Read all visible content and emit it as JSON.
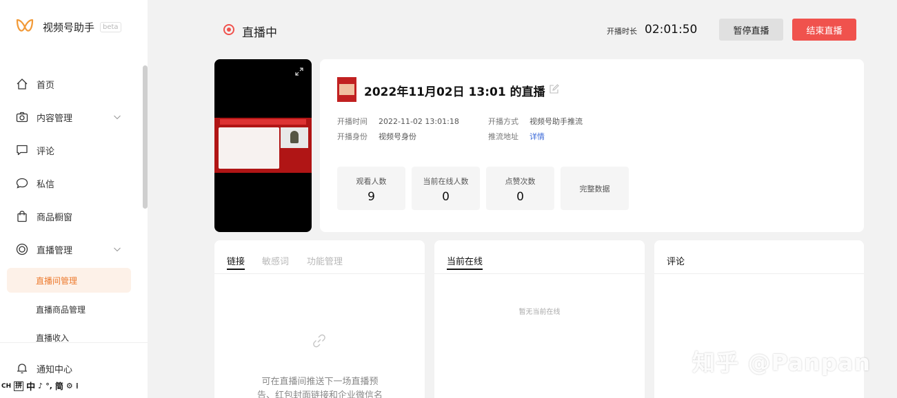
{
  "brand": {
    "name": "视频号助手",
    "badge": "beta",
    "accent": "#f29a38"
  },
  "sidebar": {
    "items": [
      {
        "label": "首页",
        "icon": "home-icon"
      },
      {
        "label": "内容管理",
        "icon": "camera-icon",
        "expandable": true
      },
      {
        "label": "评论",
        "icon": "comment-icon"
      },
      {
        "label": "私信",
        "icon": "message-icon"
      },
      {
        "label": "商品橱窗",
        "icon": "shopping-bag-icon"
      },
      {
        "label": "直播管理",
        "icon": "live-icon",
        "expandable": true
      }
    ],
    "sub_items": [
      {
        "label": "直播间管理",
        "active": true
      },
      {
        "label": "直播商品管理",
        "active": false
      },
      {
        "label": "直播收入",
        "active": false
      }
    ],
    "notification": {
      "label": "通知中心",
      "icon": "bell-icon"
    }
  },
  "ime": {
    "items": [
      "CH",
      "拼",
      "中",
      "♪",
      "°,",
      "简",
      "⚙",
      "⁞"
    ]
  },
  "header": {
    "status": "直播中",
    "duration_label": "开播时长",
    "duration": "02:01:50",
    "pause_label": "暂停直播",
    "end_label": "结束直播",
    "end_color": "#f0524d"
  },
  "live": {
    "title": "2022年11月02日 13:01 的直播",
    "meta": [
      {
        "key": "开播时间",
        "value": "2022-11-02 13:01:18"
      },
      {
        "key": "开播方式",
        "value": "视频号助手推流"
      },
      {
        "key": "开播身份",
        "value": "视频号身份"
      },
      {
        "key": "推流地址",
        "value": "详情"
      }
    ],
    "stats": [
      {
        "label": "观看人数",
        "value": "9"
      },
      {
        "label": "当前在线人数",
        "value": "0"
      },
      {
        "label": "点赞次数",
        "value": "0"
      }
    ],
    "full_data_label": "完整数据"
  },
  "panels": {
    "links": {
      "tabs": [
        "链接",
        "敏感词",
        "功能管理"
      ],
      "description": "可在直播间推送下一场直播预告、红包封面链接和企业微信名片"
    },
    "online": {
      "title": "当前在线",
      "empty": "暂无当前在线"
    },
    "comments": {
      "title": "评论"
    }
  },
  "watermark": "知乎 @Panpan"
}
